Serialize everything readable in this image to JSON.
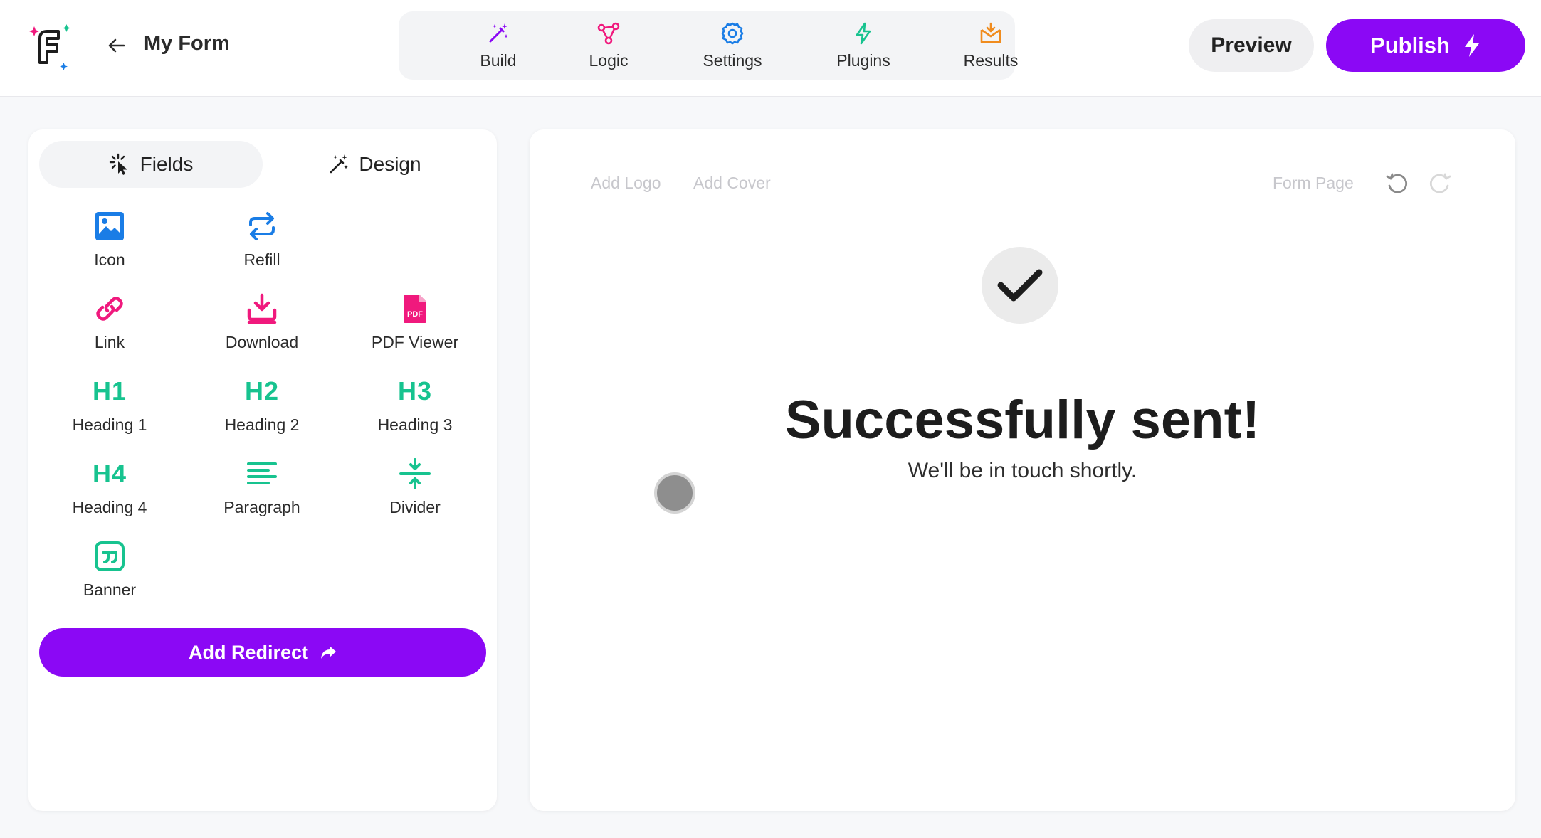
{
  "header": {
    "form_title": "My Form",
    "nav": [
      {
        "label": "Build",
        "icon": "magic-wand-icon",
        "color": "#8b08f5"
      },
      {
        "label": "Logic",
        "icon": "logic-graph-icon",
        "color": "#f0197d"
      },
      {
        "label": "Settings",
        "icon": "gear-icon",
        "color": "#1a7de6"
      },
      {
        "label": "Plugins",
        "icon": "lightning-icon",
        "color": "#17c38f"
      },
      {
        "label": "Results",
        "icon": "inbox-icon",
        "color": "#f08c1e"
      }
    ],
    "preview_label": "Preview",
    "publish_label": "Publish"
  },
  "left_panel": {
    "tabs": [
      {
        "label": "Fields",
        "icon": "pointer-click-icon",
        "active": true
      },
      {
        "label": "Design",
        "icon": "magic-wand-icon",
        "active": false
      }
    ],
    "fields": [
      {
        "label": "Icon",
        "icon": "image-icon",
        "color": "#1a7de6"
      },
      {
        "label": "Refill",
        "icon": "repeat-icon",
        "color": "#1a7de6"
      },
      {
        "label": "Link",
        "icon": "link-icon",
        "color": "#f0197d"
      },
      {
        "label": "Download",
        "icon": "download-icon",
        "color": "#f0197d"
      },
      {
        "label": "PDF Viewer",
        "icon": "pdf-file-icon",
        "color": "#f0197d",
        "badge": "PDF"
      },
      {
        "label": "Heading 1",
        "text": "H1",
        "color": "#17c38f"
      },
      {
        "label": "Heading 2",
        "text": "H2",
        "color": "#17c38f"
      },
      {
        "label": "Heading 3",
        "text": "H3",
        "color": "#17c38f"
      },
      {
        "label": "Heading 4",
        "text": "H4",
        "color": "#17c38f"
      },
      {
        "label": "Paragraph",
        "icon": "paragraph-icon",
        "color": "#17c38f"
      },
      {
        "label": "Divider",
        "icon": "divider-icon",
        "color": "#17c38f"
      },
      {
        "label": "Banner",
        "icon": "quote-banner-icon",
        "color": "#17c38f"
      }
    ],
    "redirect_label": "Add Redirect"
  },
  "canvas": {
    "add_logo": "Add Logo",
    "add_cover": "Add Cover",
    "form_page": "Form Page",
    "success_title": "Successfully sent!",
    "success_subtitle": "We'll be in touch shortly."
  },
  "colors": {
    "accent": "#8b08f5",
    "pink": "#f0197d",
    "blue": "#1a7de6",
    "green": "#17c38f",
    "orange": "#f08c1e"
  }
}
